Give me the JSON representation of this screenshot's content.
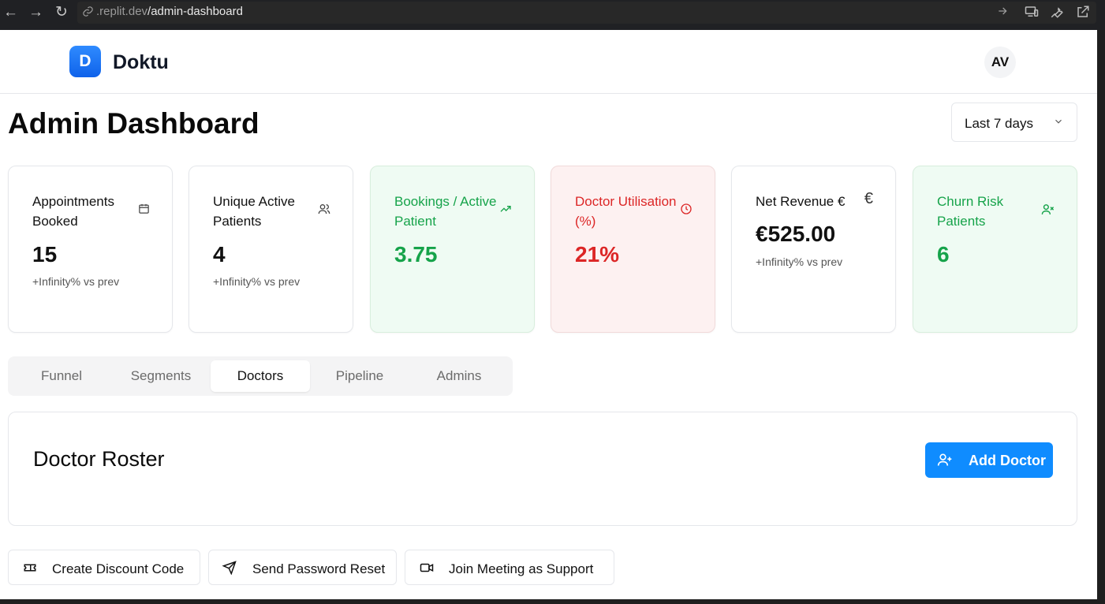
{
  "browser": {
    "url_host": ".replit.dev",
    "url_path": "/admin-dashboard"
  },
  "header": {
    "logo_letter": "D",
    "brand": "Doktu",
    "avatar_initials": "AV"
  },
  "page": {
    "title": "Admin Dashboard",
    "date_range": "Last 7 days"
  },
  "stats": [
    {
      "label": "Appointments Booked",
      "value": "15",
      "sub": "+Infinity% vs prev",
      "icon": "calendar-icon",
      "tone": "neutral"
    },
    {
      "label": "Unique Active Patients",
      "value": "4",
      "sub": "+Infinity% vs prev",
      "icon": "users-icon",
      "tone": "neutral"
    },
    {
      "label": "Bookings / Active Patient",
      "value": "3.75",
      "sub": "",
      "icon": "trending-up-icon",
      "tone": "green"
    },
    {
      "label": "Doctor Utilisation (%)",
      "value": "21%",
      "sub": "",
      "icon": "clock-icon",
      "tone": "red"
    },
    {
      "label": "Net Revenue €",
      "value": "€525.00",
      "sub": "+Infinity% vs prev",
      "icon": "euro-icon",
      "tone": "neutral"
    },
    {
      "label": "Churn Risk Patients",
      "value": "6",
      "sub": "",
      "icon": "user-x-icon",
      "tone": "green"
    }
  ],
  "tabs": [
    {
      "label": "Funnel",
      "active": false
    },
    {
      "label": "Segments",
      "active": false
    },
    {
      "label": "Doctors",
      "active": true
    },
    {
      "label": "Pipeline",
      "active": false
    },
    {
      "label": "Admins",
      "active": false
    }
  ],
  "roster": {
    "title": "Doctor Roster",
    "add_button": "Add Doctor"
  },
  "actions": [
    {
      "label": "Create Discount Code",
      "icon": "ticket-icon"
    },
    {
      "label": "Send Password Reset",
      "icon": "send-icon"
    },
    {
      "label": "Join Meeting as Support",
      "icon": "video-icon"
    }
  ],
  "colors": {
    "accent": "#0f8cff",
    "green": "#16a34a",
    "red": "#dc2626"
  }
}
